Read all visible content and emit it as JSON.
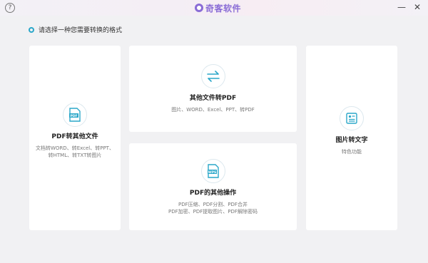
{
  "titlebar": {
    "help_label": "?",
    "app_name": "奇客软件",
    "minimize_label": "—",
    "close_label": "✕"
  },
  "section": {
    "label": "请选择一种您需要转换的格式"
  },
  "cards": {
    "pdf_to_other": {
      "icon": "pdf-file-icon",
      "title": "PDF转其他文件",
      "desc_line1": "文档转WORD、转Excel、转PPT、",
      "desc_line2": "转HTML、转TXT转图片"
    },
    "other_to_pdf": {
      "icon": "swap-arrows-icon",
      "title": "其他文件转PDF",
      "desc_line1": "图片、WORD、Excel、PPT、转PDF"
    },
    "pdf_ops": {
      "icon": "wps-file-icon",
      "title": "PDF的其他操作",
      "desc_line1": "PDF压缩、PDF分割、PDF合并",
      "desc_line2": "PDF加密、PDF提取图片、PDF解除密码"
    },
    "image_text": {
      "icon": "image-text-icon",
      "title": "图片转文字",
      "desc_line1": "特色功能"
    }
  },
  "colors": {
    "accent": "#2aa7c9",
    "background": "#f1f1f3",
    "brand": "#8a6cd6"
  }
}
